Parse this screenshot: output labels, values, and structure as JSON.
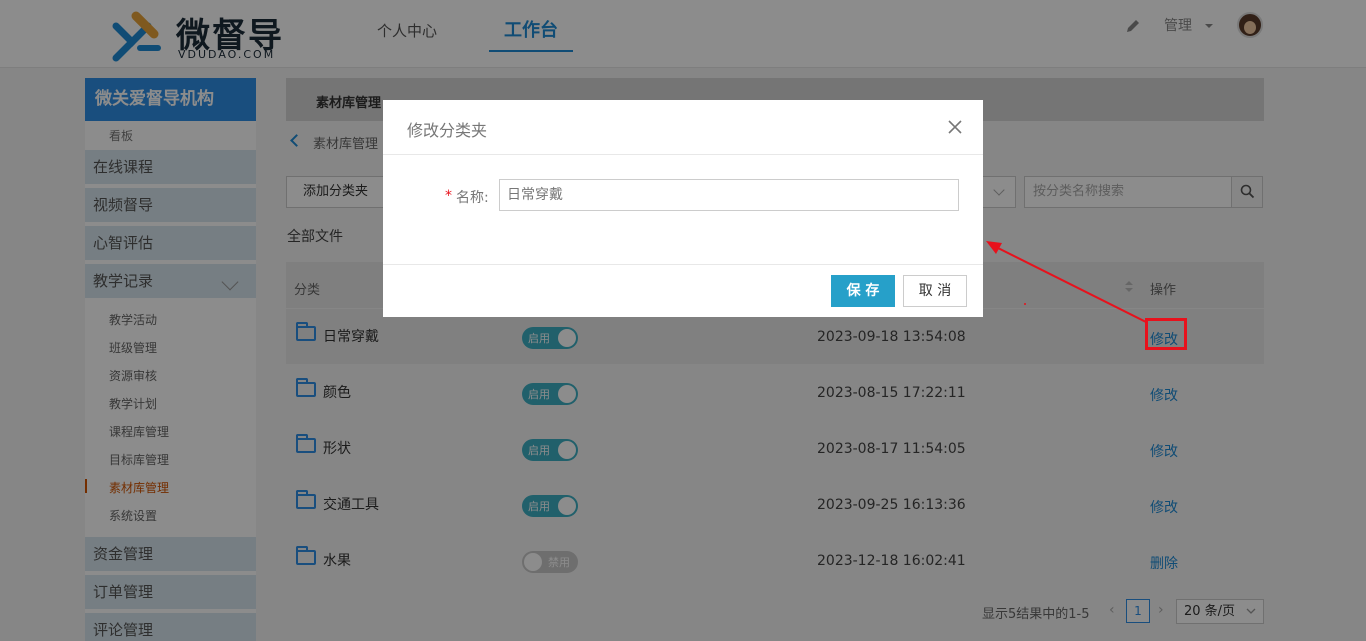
{
  "header": {
    "logo_text": "微督导",
    "logo_sub": "VDUDAO.COM",
    "nav": [
      {
        "label": "个人中心",
        "active": false
      },
      {
        "label": "工作台",
        "active": true
      }
    ],
    "admin_label": "管理"
  },
  "sidebar": {
    "org": "微关爱督导机构",
    "board": "看板",
    "main_items": [
      "在线课程",
      "视频督导",
      "心智评估",
      "教学记录"
    ],
    "sub_items": [
      "教学活动",
      "班级管理",
      "资源审核",
      "教学计划",
      "课程库管理",
      "目标库管理",
      "素材库管理",
      "系统设置"
    ],
    "active_sub": "素材库管理",
    "bottom_items": [
      "资金管理",
      "订单管理",
      "评论管理"
    ]
  },
  "main": {
    "tab": "素材库管理",
    "breadcrumb": "素材库管理",
    "add_button": "添加分类夹",
    "search_placeholder": "按分类名称搜索",
    "all_files": "全部文件",
    "columns": {
      "category": "分类",
      "operation": "操作"
    },
    "rows": [
      {
        "name": "日常穿戴",
        "status": "启用",
        "enabled": true,
        "date": "2023-09-18 13:54:08",
        "op": "修改"
      },
      {
        "name": "颜色",
        "status": "启用",
        "enabled": true,
        "date": "2023-08-15 17:22:11",
        "op": "修改"
      },
      {
        "name": "形状",
        "status": "启用",
        "enabled": true,
        "date": "2023-08-17 11:54:05",
        "op": "修改"
      },
      {
        "name": "交通工具",
        "status": "启用",
        "enabled": true,
        "date": "2023-09-25 16:13:36",
        "op": "修改"
      },
      {
        "name": "水果",
        "status": "禁用",
        "enabled": false,
        "date": "2023-12-18 16:02:41",
        "op": "删除"
      }
    ],
    "pager": {
      "summary": "显示5结果中的1-5",
      "page": "1",
      "page_size": "20 条/页"
    }
  },
  "modal": {
    "title": "修改分类夹",
    "field_label": "名称:",
    "field_required": "*",
    "field_value": "日常穿戴",
    "save": "保 存",
    "cancel": "取 消"
  },
  "colors": {
    "accent": "#2e8ee6",
    "toggle_on": "#3db0c4",
    "save": "#26a0c9",
    "annotation": "#e8111c"
  }
}
